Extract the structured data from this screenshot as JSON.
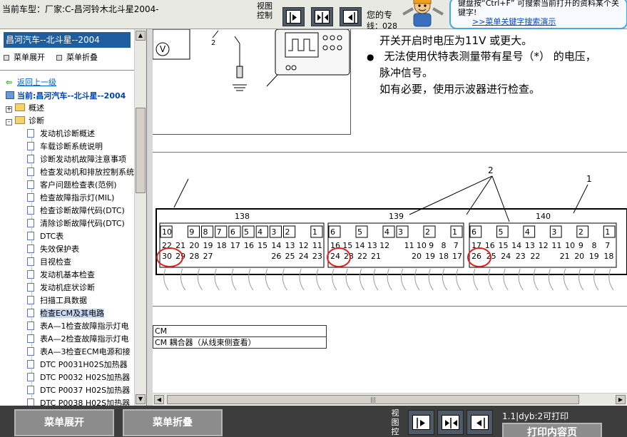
{
  "topbar": {
    "car_label": "当前车型：厂家:C-昌河铃木北斗星2004-",
    "view_label": "视图控制",
    "expert_label": "您的专",
    "expert_label2": "线：028",
    "tip_line1": "键盘按“Ctrl+F” 可搜索当前打开的资料某个关键字!",
    "tip_link": ">>菜单关键字搜索演示"
  },
  "sidebar": {
    "title": "昌河汽车--北斗星--2004",
    "expand_label": "菜单展开",
    "collapse_label": "菜单折叠",
    "back_label": "返回上一级",
    "current_label": "当前:昌河汽车--北斗星--2004",
    "folders": [
      {
        "label": "概述",
        "state": "+"
      },
      {
        "label": "诊断",
        "state": "-"
      }
    ],
    "items": [
      {
        "label": "发动机诊断概述",
        "selected": false
      },
      {
        "label": "车载诊断系统说明",
        "selected": false
      },
      {
        "label": "诊断发动机故障注意事项",
        "selected": false
      },
      {
        "label": "检查发动机和排放控制系统",
        "selected": false
      },
      {
        "label": "客户问题检查表(范例)",
        "selected": false
      },
      {
        "label": "检查故障指示灯(MIL)",
        "selected": false
      },
      {
        "label": "检查诊断故障代码(DTC)",
        "selected": false
      },
      {
        "label": "清除诊断故障代码(DTC)",
        "selected": false
      },
      {
        "label": "DTC表",
        "selected": false
      },
      {
        "label": "失效保护表",
        "selected": false
      },
      {
        "label": "目视检查",
        "selected": false
      },
      {
        "label": "发动机基本检查",
        "selected": false
      },
      {
        "label": "发动机症状诊断",
        "selected": false
      },
      {
        "label": "扫描工具数据",
        "selected": false
      },
      {
        "label": "检查ECM及其电路",
        "selected": true
      },
      {
        "label": "表A—1检查故障指示灯电",
        "selected": false
      },
      {
        "label": "表A—2检查故障指示灯电",
        "selected": false
      },
      {
        "label": "表A—3检查ECM电源和接",
        "selected": false
      },
      {
        "label": "DTC P0031H02S加热器",
        "selected": false
      },
      {
        "label": "DTC P0032 H02S加热器",
        "selected": false
      },
      {
        "label": "DTC P0037 H02S加热器",
        "selected": false
      },
      {
        "label": "DTC P0038 H02S加热器",
        "selected": false
      }
    ]
  },
  "content": {
    "line1": "开关开启时电压为11V 或更大。",
    "bullet2": "无法使用伏特表测量带有星号（*） 的电压，",
    "line3": "脉冲信号。",
    "line4": "如有必要，使用示波器进行检查。",
    "fig1_label_v": "V",
    "fig1_label_2": "2",
    "callout_2": "2",
    "callout_1": "1",
    "connectors": [
      {
        "name": "138",
        "top": [
          "10",
          "",
          "9",
          "8",
          "7",
          "6",
          "5",
          "4",
          "3",
          "2",
          "",
          "1"
        ],
        "mid": [
          "22",
          "21",
          "20",
          "19",
          "18",
          "17",
          "16",
          "15",
          "14",
          "13",
          "12",
          "11"
        ],
        "bot": [
          "30",
          "29",
          "28",
          "27",
          "",
          "",
          "",
          "",
          "26",
          "25",
          "24",
          "23"
        ]
      },
      {
        "name": "139",
        "top": [
          "6",
          "",
          "5",
          "",
          "4",
          "3",
          "",
          "2",
          "",
          "1"
        ],
        "mid": [
          "16",
          "15",
          "14",
          "13",
          "12",
          "",
          "11",
          "10",
          "9",
          "8",
          "7"
        ],
        "bot": [
          "24",
          "23",
          "22",
          "21",
          "",
          "",
          "20",
          "19",
          "18",
          "17"
        ]
      },
      {
        "name": "140",
        "top": [
          "6",
          "",
          "5",
          "",
          "4",
          "",
          "3",
          "",
          "2",
          "",
          "1"
        ],
        "mid": [
          "17",
          "16",
          "15",
          "14",
          "13",
          "12",
          "11",
          "10",
          "9",
          "8",
          "7"
        ],
        "bot": [
          "26",
          "25",
          "24",
          "23",
          "22",
          "",
          "21",
          "20",
          "19",
          "18"
        ]
      }
    ],
    "table_row1": "CM",
    "table_row2": "CM 耦合器（从线束侧查看）"
  },
  "bottombar": {
    "expand_label": "菜单展开",
    "collapse_label": "菜单折叠",
    "view_label": "视图控",
    "print_info": "1.1|dyb:2可打印",
    "print_label": "打印内容页"
  },
  "colors": {
    "sidebar_title_bg": "#1e5e9e",
    "bottom_bg": "#3d3d3d",
    "button_bg": "#8c8c8c",
    "link_color": "#0066cc",
    "highlight_circle": "#e02020"
  }
}
